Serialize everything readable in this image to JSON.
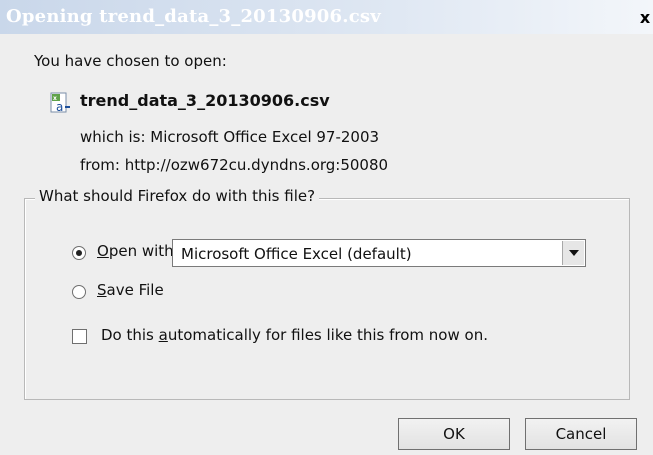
{
  "window": {
    "title": "Opening trend_data_3_20130906.csv",
    "close_label": "x"
  },
  "intro": "You have chosen to open:",
  "file": {
    "name": "trend_data_3_20130906.csv",
    "icon": "excel-csv-file-icon",
    "which_is_label": "which is:",
    "which_is_value": "Microsoft Office Excel 97-2003",
    "from_label": "from:",
    "from_value": "http://ozw672cu.dyndns.org:50080"
  },
  "action_group": {
    "legend": "What should Firefox do with this file?",
    "open_with": {
      "label_prefix": "",
      "label_underlined": "O",
      "label_suffix": "pen with",
      "selected": true,
      "application": "Microsoft Office Excel (default)"
    },
    "save_file": {
      "label_underlined": "S",
      "label_suffix": "ave File",
      "selected": false
    },
    "auto": {
      "label_prefix": "Do this ",
      "label_underlined": "a",
      "label_suffix": "utomatically for files like this from now on.",
      "checked": false
    }
  },
  "buttons": {
    "ok": "OK",
    "cancel": "Cancel"
  }
}
